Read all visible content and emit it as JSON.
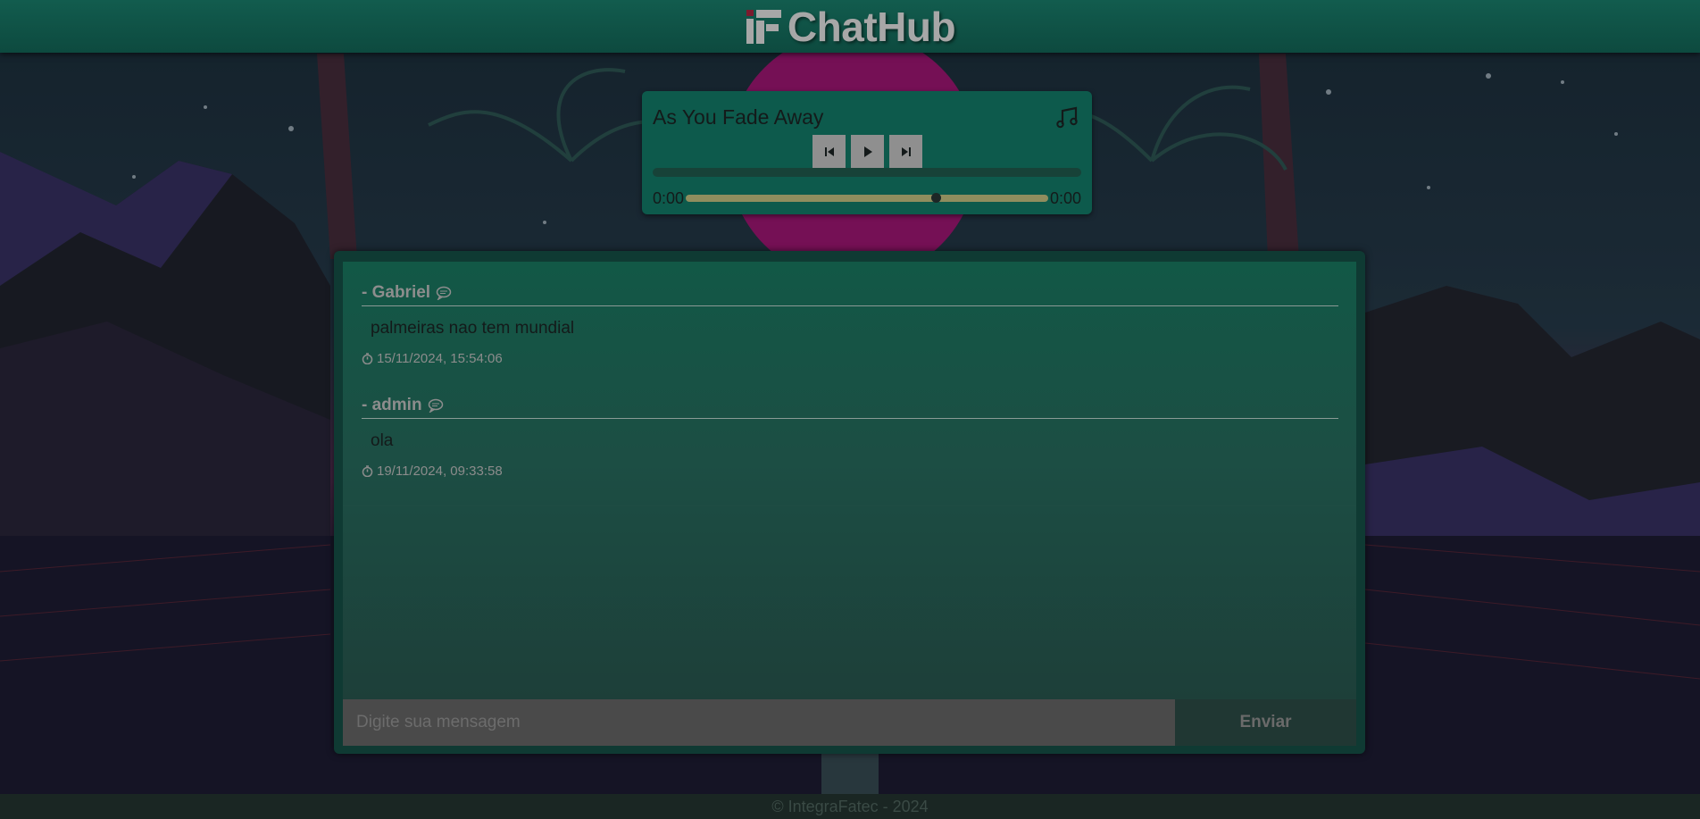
{
  "header": {
    "brand": "ChatHub"
  },
  "player": {
    "song_title": "As You Fade Away",
    "current_time": "0:00",
    "duration": "0:00",
    "seek_position": 0.69,
    "icons": {
      "music": "music-note-icon",
      "prev": "skip-previous-icon",
      "play": "play-icon",
      "next": "skip-next-icon"
    }
  },
  "chat": {
    "messages": [
      {
        "author": "- Gabriel",
        "text": "palmeiras nao tem mundial",
        "timestamp": "15/11/2024, 15:54:06"
      },
      {
        "author": "- admin",
        "text": "ola",
        "timestamp": "19/11/2024, 09:33:58"
      }
    ],
    "input": {
      "placeholder": "Digite sua mensagem",
      "value": ""
    },
    "send_label": "Enviar"
  },
  "footer": {
    "text": "© IntegraFatec - 2024"
  },
  "colors": {
    "accent": "#0d5a4c",
    "header": "#125c4e",
    "magenta": "#b0127a"
  }
}
